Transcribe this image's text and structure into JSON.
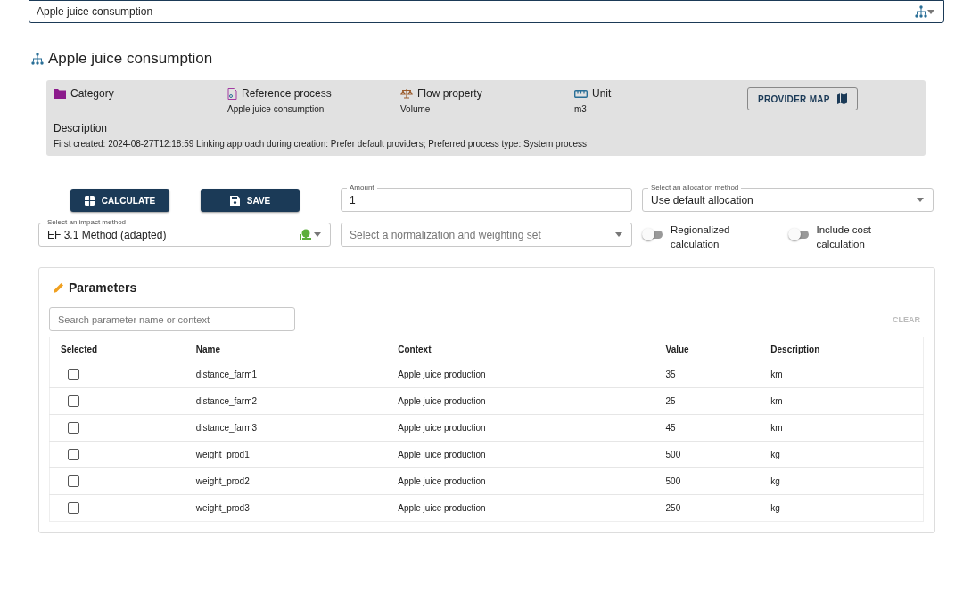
{
  "product_system": {
    "value": "Apple juice consumption"
  },
  "heading": "Apple juice consumption",
  "info": {
    "fields": [
      {
        "kind": "category",
        "label": "Category"
      },
      {
        "kind": "process",
        "label": "Reference process",
        "value": "Apple juice consumption"
      },
      {
        "kind": "property",
        "label": "Flow property",
        "value": "Volume"
      },
      {
        "kind": "unit",
        "label": "Unit",
        "value": "m3"
      }
    ],
    "provider_map_button": "PROVIDER MAP",
    "description_label": "Description",
    "description": "First created: 2024-08-27T12:18:59 Linking approach during creation: Prefer default providers; Preferred process type: System process"
  },
  "buttons": [
    {
      "kind": "calculate",
      "label": "CALCULATE"
    },
    {
      "kind": "save",
      "label": "SAVE"
    }
  ],
  "amount": {
    "label": "Amount",
    "value": "1"
  },
  "allocation": {
    "label": "Select an allocation method",
    "value": "Use default allocation"
  },
  "impact_method": {
    "label": "Select an impact method",
    "value": "EF 3.1 Method (adapted)"
  },
  "normalization": {
    "placeholder": "Select a normalization and weighting set"
  },
  "toggles": [
    {
      "label": "Regionalized calculation",
      "on": false
    },
    {
      "label": "Include cost calculation",
      "on": false
    }
  ],
  "parameters": {
    "title": "Parameters",
    "search_placeholder": "Search parameter name or context",
    "clear_button": "CLEAR",
    "columns": [
      "Selected",
      "Name",
      "Context",
      "Value",
      "Description"
    ],
    "rows": [
      {
        "selected": false,
        "name": "distance_farm1",
        "context": "Apple juice production",
        "value": "35",
        "description": "km"
      },
      {
        "selected": false,
        "name": "distance_farm2",
        "context": "Apple juice production",
        "value": "25",
        "description": "km"
      },
      {
        "selected": false,
        "name": "distance_farm3",
        "context": "Apple juice production",
        "value": "45",
        "description": "km"
      },
      {
        "selected": false,
        "name": "weight_prod1",
        "context": "Apple juice production",
        "value": "500",
        "description": "kg"
      },
      {
        "selected": false,
        "name": "weight_prod2",
        "context": "Apple juice production",
        "value": "500",
        "description": "kg"
      },
      {
        "selected": false,
        "name": "weight_prod3",
        "context": "Apple juice production",
        "value": "250",
        "description": "kg"
      }
    ]
  }
}
